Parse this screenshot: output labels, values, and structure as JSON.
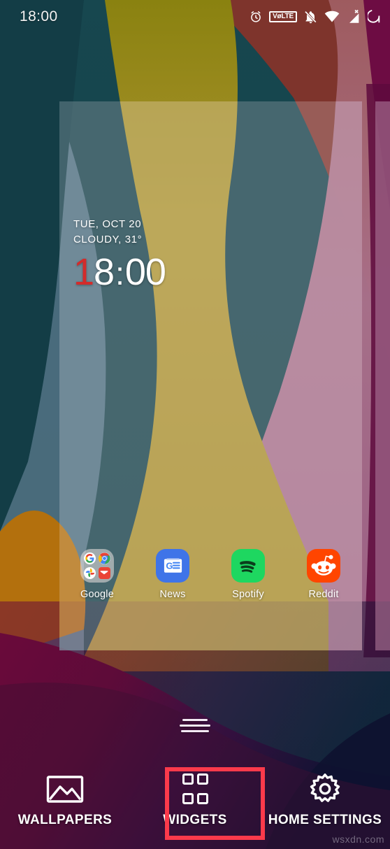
{
  "status_bar": {
    "time": "18:00",
    "icons": [
      {
        "name": "alarm-icon",
        "label": "alarm"
      },
      {
        "name": "volte-icon",
        "label": "VoLTE"
      },
      {
        "name": "notifications-muted-icon",
        "label": "notifications off"
      },
      {
        "name": "wifi-icon",
        "label": "wifi"
      },
      {
        "name": "cellular-signal-off-icon",
        "label": "no signal"
      },
      {
        "name": "battery-icon",
        "label": "battery"
      }
    ]
  },
  "clock_widget": {
    "date": "TUE, OCT 20",
    "weather": "CLOUDY, 31°",
    "time_hour_first": "1",
    "time_hour_rest": "8",
    "time_colon": ":",
    "time_minutes": "00",
    "accent_color": "#d32b2b"
  },
  "apps": [
    {
      "name": "google-folder",
      "label": "Google",
      "icon": "google-folder-icon"
    },
    {
      "name": "news-app",
      "label": "News",
      "icon": "google-news-icon"
    },
    {
      "name": "spotify-app",
      "label": "Spotify",
      "icon": "spotify-icon"
    },
    {
      "name": "reddit-app",
      "label": "Reddit",
      "icon": "reddit-icon"
    }
  ],
  "options_bar": {
    "items": [
      {
        "name": "wallpapers-option",
        "label": "WALLPAPERS",
        "icon": "image-icon",
        "highlighted": false
      },
      {
        "name": "widgets-option",
        "label": "WIDGETS",
        "icon": "grid-icon",
        "highlighted": true
      },
      {
        "name": "home-settings-option",
        "label": "HOME SETTINGS",
        "icon": "gear-icon",
        "highlighted": false
      }
    ],
    "highlight_color": "#fb3a4b"
  },
  "drag_handle": {
    "name": "page-drag-handle"
  },
  "watermark": {
    "text": "wsxdn.com"
  },
  "wallpaper": {
    "colors": {
      "teal": "#17414a",
      "olive": "#8a8210",
      "maroon": "#7e342c",
      "gold": "#b39536",
      "steel_blue": "#557183",
      "mauve": "#a9708a",
      "orange": "#b3700d",
      "magenta": "#6e0a3c",
      "deep_purple": "#3a1240",
      "navy": "#121638"
    }
  }
}
